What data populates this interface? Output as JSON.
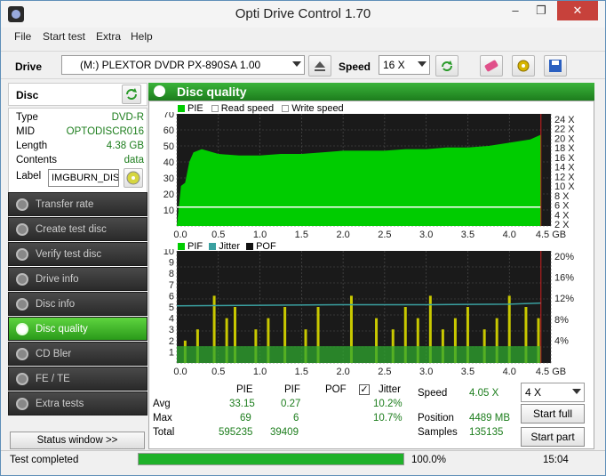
{
  "window": {
    "title": "Opti Drive Control 1.70",
    "min": "–",
    "max": "❐",
    "close": "✕"
  },
  "menu": [
    "File",
    "Start test",
    "Extra",
    "Help"
  ],
  "toolbar": {
    "drive_label": "Drive",
    "drive_value": "(M:)   PLEXTOR DVDR   PX-890SA 1.00",
    "speed_label": "Speed",
    "speed_value": "16 X"
  },
  "disc": {
    "header": "Disc",
    "rows": [
      {
        "key": "Type",
        "value": "DVD-R"
      },
      {
        "key": "MID",
        "value": "OPTODISCR016"
      },
      {
        "key": "Length",
        "value": "4.38 GB"
      },
      {
        "key": "Contents",
        "value": "data"
      }
    ],
    "label_key": "Label",
    "label_value": "IMGBURN_DIS"
  },
  "nav": [
    {
      "label": "Transfer rate",
      "active": false
    },
    {
      "label": "Create test disc",
      "active": false
    },
    {
      "label": "Verify test disc",
      "active": false
    },
    {
      "label": "Drive info",
      "active": false
    },
    {
      "label": "Disc info",
      "active": false
    },
    {
      "label": "Disc quality",
      "active": true
    },
    {
      "label": "CD Bler",
      "active": false
    },
    {
      "label": "FE / TE",
      "active": false
    },
    {
      "label": "Extra tests",
      "active": false
    }
  ],
  "status_window_button": "Status window >>",
  "panel_title": "Disc quality",
  "chart_data": [
    {
      "type": "area",
      "legend": [
        "PIE",
        "Read speed",
        "Write speed"
      ],
      "x_ticks": [
        "0.0",
        "0.5",
        "1.0",
        "1.5",
        "2.0",
        "2.5",
        "3.0",
        "3.5",
        "4.0",
        "4.5 GB"
      ],
      "y_left_ticks": [
        "70",
        "60",
        "50",
        "40",
        "30",
        "20",
        "10"
      ],
      "y_right_ticks": [
        "24 X",
        "22 X",
        "20 X",
        "18 X",
        "16 X",
        "14 X",
        "12 X",
        "10 X",
        "8 X",
        "6 X",
        "4 X",
        "2 X"
      ],
      "xlim": [
        0,
        4.5
      ],
      "ylim": [
        0,
        70
      ],
      "series": [
        {
          "name": "PIE",
          "color": "#00cc00",
          "x": [
            0.0,
            0.05,
            0.1,
            0.15,
            0.2,
            0.3,
            0.5,
            0.75,
            1.0,
            1.25,
            1.5,
            1.75,
            2.0,
            2.25,
            2.5,
            2.75,
            3.0,
            3.25,
            3.5,
            3.75,
            4.0,
            4.25,
            4.38
          ],
          "y": [
            0,
            25,
            27,
            40,
            46,
            48,
            45,
            44,
            44,
            45,
            45,
            46,
            47,
            47,
            47,
            48,
            48,
            49,
            49,
            50,
            52,
            54,
            57
          ]
        },
        {
          "name": "Read speed",
          "color": "#ffffff",
          "x": [
            0.0,
            4.38
          ],
          "y": [
            4.05,
            4.05
          ]
        }
      ]
    },
    {
      "type": "bar",
      "legend": [
        "PIF",
        "Jitter",
        "POF"
      ],
      "x_ticks": [
        "0.0",
        "0.5",
        "1.0",
        "1.5",
        "2.0",
        "2.5",
        "3.0",
        "3.5",
        "4.0",
        "4.5 GB"
      ],
      "y_left_ticks": [
        "10",
        "9",
        "8",
        "7",
        "6",
        "5",
        "4",
        "3",
        "2",
        "1"
      ],
      "y_right_ticks": [
        "20%",
        "16%",
        "12%",
        "8%",
        "4%"
      ],
      "xlim": [
        0,
        4.5
      ],
      "ylim": [
        0,
        10
      ],
      "series": [
        {
          "name": "PIF",
          "color": "#c8c800",
          "x": [
            0.1,
            0.25,
            0.45,
            0.6,
            0.7,
            0.95,
            1.1,
            1.3,
            1.55,
            1.7,
            2.1,
            2.4,
            2.6,
            2.75,
            2.9,
            3.05,
            3.2,
            3.35,
            3.5,
            3.7,
            3.85,
            4.0,
            4.2,
            4.35
          ],
          "y": [
            2,
            3,
            6,
            4,
            5,
            3,
            4,
            5,
            3,
            5,
            6,
            4,
            3,
            5,
            4,
            6,
            3,
            4,
            5,
            3,
            4,
            6,
            5,
            4
          ]
        },
        {
          "name": "Jitter",
          "color": "#3aa0a0",
          "x": [
            0.0,
            1.0,
            2.0,
            3.0,
            4.0,
            4.38
          ],
          "y": [
            10.2,
            10.3,
            10.4,
            10.4,
            10.5,
            10.7
          ]
        }
      ]
    }
  ],
  "stats": {
    "col_headers": [
      "PIE",
      "PIF",
      "POF",
      "Jitter"
    ],
    "jitter_checked": "✓",
    "rows": [
      {
        "label": "Avg",
        "pie": "33.15",
        "pif": "0.27",
        "jitter": "10.2%"
      },
      {
        "label": "Max",
        "pie": "69",
        "pif": "6",
        "jitter": "10.7%"
      },
      {
        "label": "Total",
        "pie": "595235",
        "pif": "39409"
      }
    ],
    "speed_label": "Speed",
    "speed_value": "4.05 X",
    "position_label": "Position",
    "position_value": "4489 MB",
    "samples_label": "Samples",
    "samples_value": "135135",
    "speed_select": "4 X",
    "start_full": "Start full",
    "start_part": "Start part"
  },
  "statusbar": {
    "text": "Test completed",
    "progress": 100,
    "progress_text": "100.0%",
    "time": "15:04"
  }
}
